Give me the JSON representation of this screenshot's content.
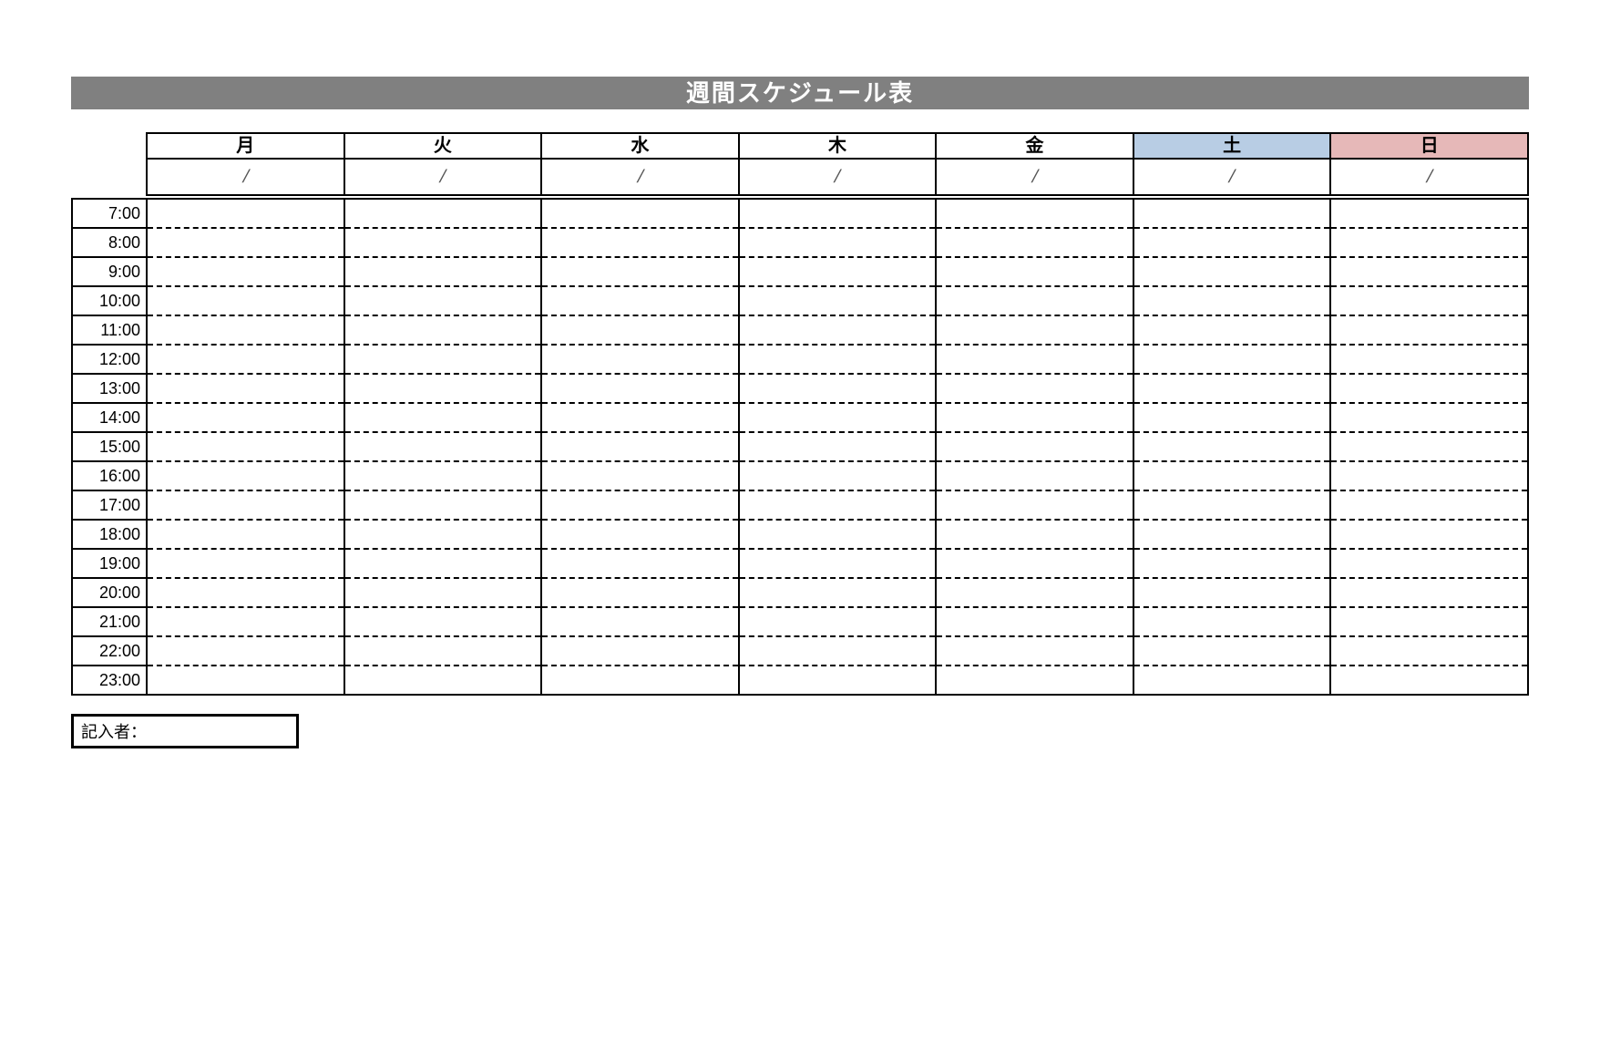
{
  "title": "週間スケジュール表",
  "days": [
    {
      "label": "月",
      "class": ""
    },
    {
      "label": "火",
      "class": ""
    },
    {
      "label": "水",
      "class": ""
    },
    {
      "label": "木",
      "class": ""
    },
    {
      "label": "金",
      "class": ""
    },
    {
      "label": "土",
      "class": "sat"
    },
    {
      "label": "日",
      "class": "sun"
    }
  ],
  "date_placeholder": "/",
  "times": [
    "7:00",
    "8:00",
    "9:00",
    "10:00",
    "11:00",
    "12:00",
    "13:00",
    "14:00",
    "15:00",
    "16:00",
    "17:00",
    "18:00",
    "19:00",
    "20:00",
    "21:00",
    "22:00",
    "23:00"
  ],
  "author_label": "記入者：",
  "author_value": "",
  "colors": {
    "title_bg": "#808080",
    "sat_bg": "#b8cde4",
    "sun_bg": "#e6b8b8"
  }
}
